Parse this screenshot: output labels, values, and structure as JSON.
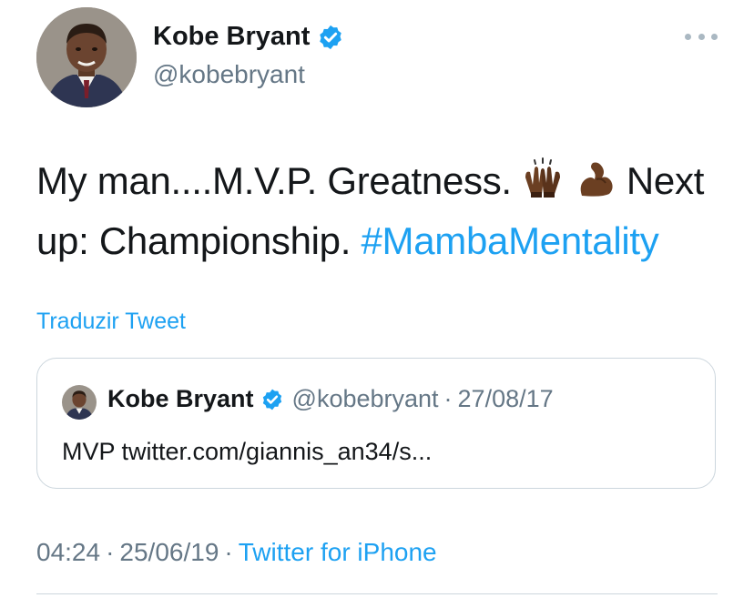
{
  "author": {
    "name": "Kobe Bryant",
    "handle": "@kobebryant",
    "avatar_icon": "profile-photo",
    "verified_icon": "verified-badge-icon"
  },
  "tweet": {
    "text_before_emoji": "My man....M.V.P. Greatness.",
    "emojis": [
      "raising-hands-dark-skin",
      "flexed-biceps-dark-skin"
    ],
    "text_after_emoji": "Next up: Championship.",
    "hashtag": "#MambaMentality"
  },
  "translate_label": "Traduzir Tweet",
  "quoted_tweet": {
    "name": "Kobe Bryant",
    "handle": "@kobebryant",
    "separator": "·",
    "date": "27/08/17",
    "text": "MVP twitter.com/giannis_an34/s..."
  },
  "meta": {
    "time": "04:24",
    "separator": "·",
    "date": "25/06/19",
    "source": "Twitter for iPhone"
  },
  "colors": {
    "accent": "#1da1f2",
    "secondary_text": "#657786",
    "primary_text": "#14171a",
    "border": "#ccd6dd"
  }
}
